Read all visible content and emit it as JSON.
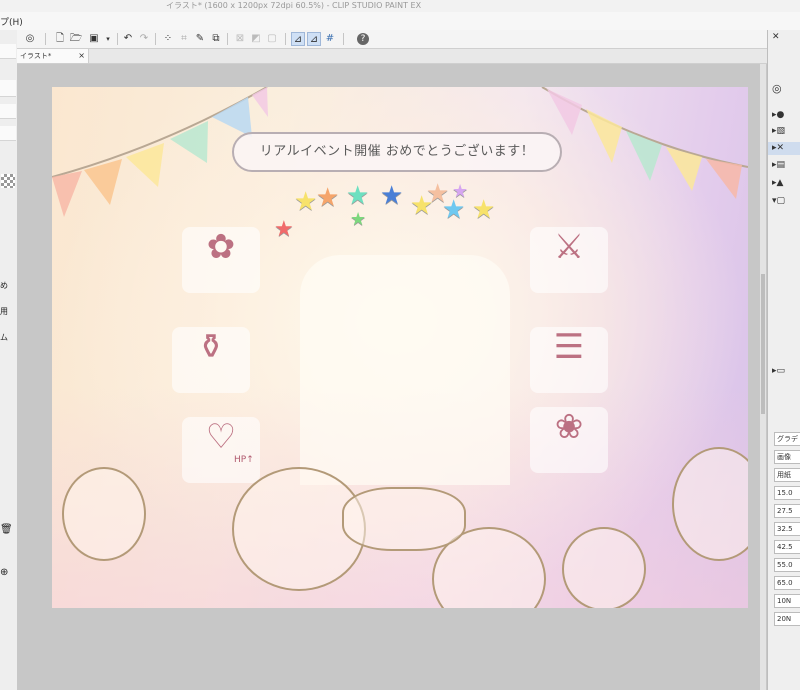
{
  "window": {
    "title": "イラスト* (1600 x 1200px 72dpi 60.5%) - CLIP STUDIO PAINT EX",
    "menu_fragment": "プ(H)"
  },
  "left_panel": {
    "labels": [
      "め",
      "用",
      "ム"
    ]
  },
  "toolbar": {
    "icons": [
      "clip-studio-icon",
      "new-file-icon",
      "open-file-icon",
      "save-icon",
      "save-dropdown-icon",
      "undo-icon",
      "redo-icon",
      "select-all-icon",
      "deselect-icon",
      "pen-tool-icon",
      "transform-icon",
      "crop-icon",
      "ruler-icon",
      "frame-icon",
      "snap-ruler-icon",
      "snap-special-ruler-icon",
      "snap-grid-icon",
      "help-icon"
    ]
  },
  "tabs": [
    {
      "label": "イラスト*",
      "close": "×"
    }
  ],
  "canvas": {
    "banner_text": "リアルイベント開催 おめでとうございます！",
    "hp_label": "HP↑"
  },
  "right_panel": {
    "items": [
      "グラデ",
      "画像",
      "用紙",
      "15.0",
      "27.5",
      "32.5",
      "42.5",
      "55.0",
      "65.0",
      "10N",
      "20N"
    ]
  }
}
